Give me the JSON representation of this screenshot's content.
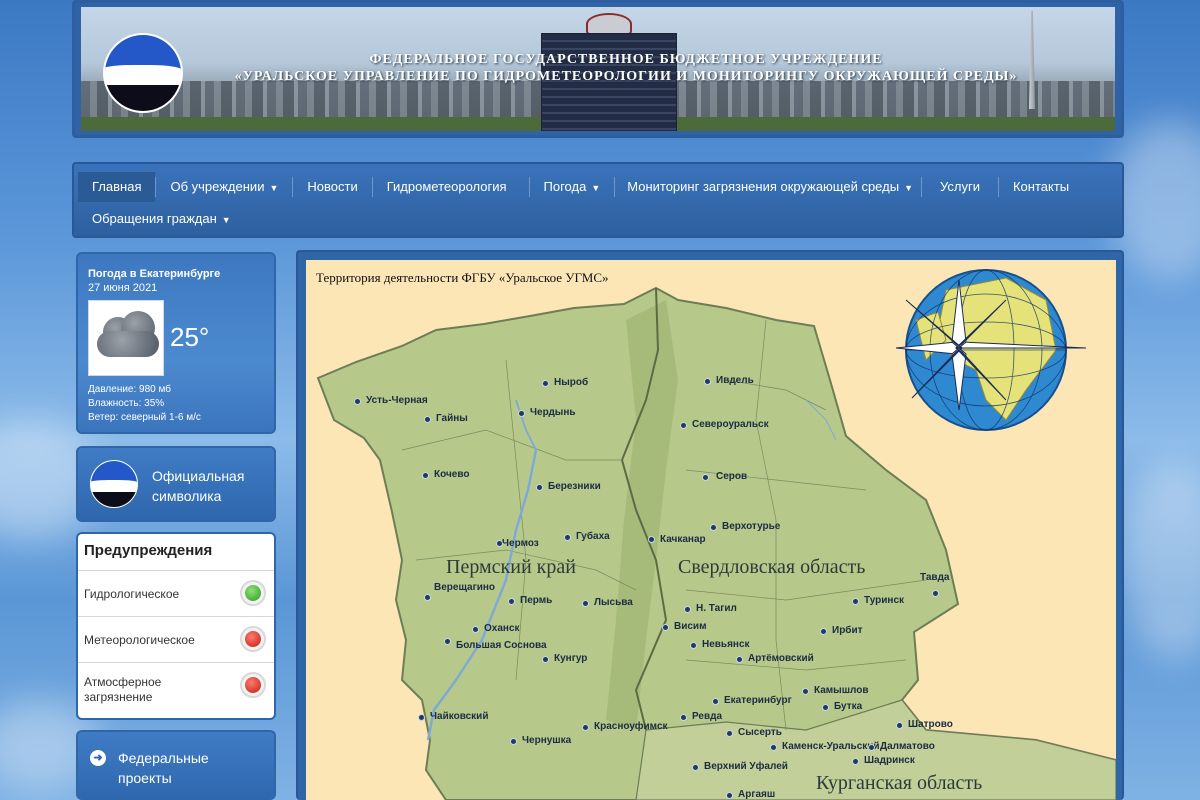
{
  "header": {
    "title_line1": "ФЕДЕРАЛЬНОЕ ГОСУДАРСТВЕННОЕ БЮДЖЕТНОЕ УЧРЕЖДЕНИЕ",
    "title_line2": "«УРАЛЬСКОЕ УПРАВЛЕНИЕ ПО ГИДРОМЕТЕОРОЛОГИИ И МОНИТОРИНГУ ОКРУЖАЮЩЕЙ СРЕДЫ»"
  },
  "nav": {
    "items": [
      {
        "label": "Главная",
        "active": true
      },
      {
        "label": "Об учреждении",
        "dropdown": true
      },
      {
        "label": "Новости"
      },
      {
        "label": "Гидрометеорология"
      },
      {
        "label": "Погода",
        "dropdown": true
      },
      {
        "label": "Мониторинг загрязнения окружающей среды",
        "dropdown": true
      },
      {
        "label": "Услуги"
      },
      {
        "label": "Контакты"
      },
      {
        "label": "Обращения граждан",
        "dropdown": true
      }
    ]
  },
  "weather": {
    "title": "Погода в Екатеринбурге",
    "date": "27 июня 2021",
    "icon": "cloudy-icon",
    "temperature": "25°",
    "pressure": "Давление: 980 мб",
    "humidity": "Влажность: 35%",
    "wind": "Ветер: северный 1-6 м/с"
  },
  "symbolics": {
    "label_line1": "Официальная",
    "label_line2": "символика"
  },
  "warnings": {
    "title": "Предупреждения",
    "items": [
      {
        "label_line1": "Гидрологическое",
        "label_line2": "",
        "status": "green"
      },
      {
        "label_line1": "Метеорологическое",
        "label_line2": "",
        "status": "red"
      },
      {
        "label_line1": "Атмосферное",
        "label_line2": "загрязнение",
        "status": "red"
      }
    ]
  },
  "federal": {
    "label_line1": "Федеральные",
    "label_line2": "проекты"
  },
  "map": {
    "caption": "Территория деятельности ФГБУ «Уральское УГМС»",
    "regions": [
      "Пермский край",
      "Свердловская область",
      "Курганская область"
    ],
    "cities": [
      "Усть-Черная",
      "Гайны",
      "Ныроб",
      "Чердынь",
      "Ивдель",
      "Североуральск",
      "Кочево",
      "Березники",
      "Серов",
      "Чермоз",
      "Губаха",
      "Качканар",
      "Верхотурье",
      "Тавда",
      "Верещагино",
      "Пермь",
      "Лысьва",
      "Н. Тагил",
      "Туринск",
      "Оханск",
      "Висим",
      "Ирбит",
      "Большая Соснова",
      "Невьянск",
      "Артёмовский",
      "Кунгур",
      "Камышлов",
      "Екатеринбург",
      "Бутка",
      "Чайковский",
      "Ревда",
      "Шатрово",
      "Чернушка",
      "Красноуфимск",
      "Сысерть",
      "Каменск-Уральский",
      "Далматово",
      "Шадринск",
      "Верхний Уфалей",
      "Аргаяш"
    ]
  },
  "colors": {
    "accent": "#2f66a8",
    "map_background": "#fce6b6",
    "map_land": "#b6c98a"
  }
}
